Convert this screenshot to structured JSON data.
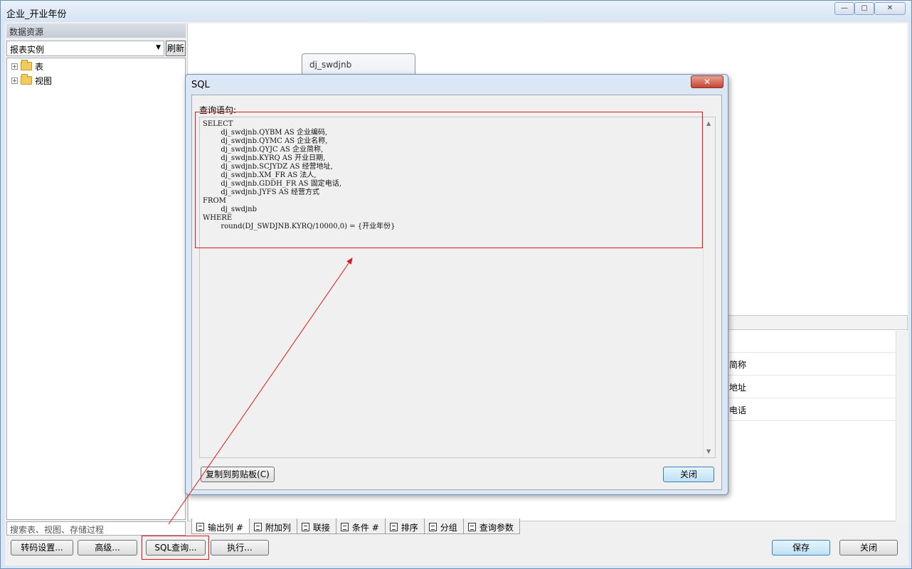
{
  "window": {
    "title": "企业_开业年份"
  },
  "left_panel": {
    "header": "数据资源",
    "combo_value": "报表实例",
    "refresh_label": "刷新",
    "tree": [
      {
        "label": "表"
      },
      {
        "label": "视图"
      }
    ],
    "search_placeholder": "搜索表、视图、存储过程"
  },
  "bottom_buttons": {
    "transcode": "转码设置...",
    "advanced": "高级...",
    "sql_query": "SQL查询...",
    "execute": "执行...",
    "save": "保存",
    "close": "关闭"
  },
  "designer": {
    "table_card_name": "dj_swdjnb",
    "grid_cells": [
      "简称",
      "地址",
      "电话"
    ]
  },
  "tabs": [
    {
      "label": "输出列 #"
    },
    {
      "label": "附加列"
    },
    {
      "label": "联接"
    },
    {
      "label": "条件 #"
    },
    {
      "label": "排序"
    },
    {
      "label": "分组"
    },
    {
      "label": "查询参数"
    }
  ],
  "sql_dialog": {
    "title": "SQL",
    "close_x": "✕",
    "label": "查询语句:",
    "sql": "SELECT\n        dj_swdjnb.QYBM AS 企业编码,\n        dj_swdjnb.QYMC AS 企业名称,\n        dj_swdjnb.QYJC AS 企业简称,\n        dj_swdjnb.KYRQ AS 开业日期,\n        dj_swdjnb.SCJYDZ AS 经营地址,\n        dj_swdjnb.XM_FR AS 法人,\n        dj_swdjnb.GDDH_FR AS 固定电话,\n        dj_swdjnb.JYFS AS 经营方式\nFROM\n        dj_swdjnb\nWHERE\n        round(DJ_SWDJNB.KYRQ/10000,0) = {开业年份}",
    "copy_button": "复制到剪贴板(C)",
    "close_button": "关闭"
  },
  "annotation_color": "#e01818"
}
